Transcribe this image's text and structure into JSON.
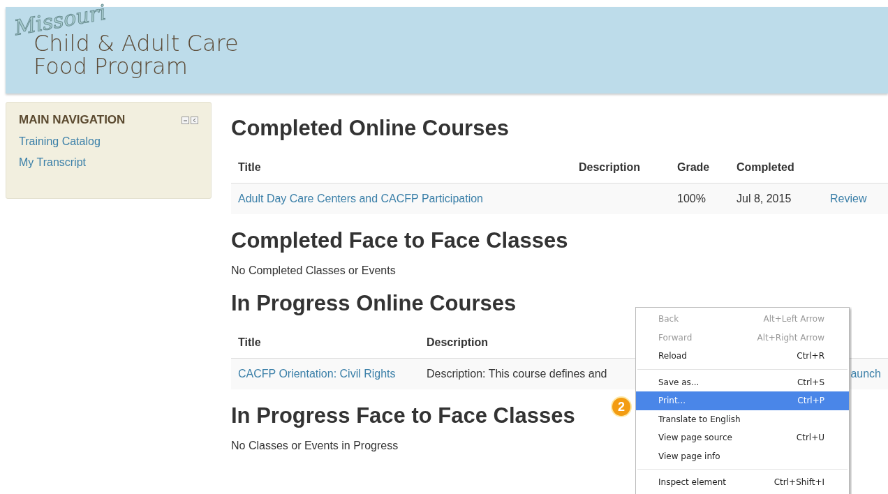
{
  "header": {
    "logo_script": "Missouri",
    "logo_line_1": "Child & Adult Care",
    "logo_line_2": "Food Program"
  },
  "sidebar": {
    "title": "MAIN NAVIGATION",
    "items": [
      {
        "label": "Training Catalog"
      },
      {
        "label": "My Transcript"
      }
    ]
  },
  "sections": [
    {
      "heading": "Completed Online Courses",
      "kind": "table",
      "columns": [
        "Title",
        "Description",
        "Grade",
        "Completed"
      ],
      "rows": [
        {
          "title": "Adult Day Care Centers and CACFP Participation",
          "grade": "100%",
          "completed": "Jul 8, 2015",
          "action": "Review"
        }
      ]
    },
    {
      "heading": "Completed Face to Face Classes",
      "kind": "empty",
      "message": "No Completed Classes or Events"
    },
    {
      "heading": "In Progress Online Courses",
      "kind": "table",
      "columns": [
        "Title",
        "Description"
      ],
      "rows": [
        {
          "title": "CACFP Orientation: Civil Rights",
          "description": "Description: This course defines and",
          "action": "aunch"
        }
      ]
    },
    {
      "heading": "In Progress Face to Face Classes",
      "kind": "empty",
      "message": "No Classes or Events in Progress"
    }
  ],
  "context_menu": {
    "items": [
      {
        "kind": "item",
        "label": "Back",
        "shortcut": "Alt+Left Arrow",
        "disabled": true,
        "selected": false
      },
      {
        "kind": "item",
        "label": "Forward",
        "shortcut": "Alt+Right Arrow",
        "disabled": true,
        "selected": false
      },
      {
        "kind": "item",
        "label": "Reload",
        "shortcut": "Ctrl+R",
        "disabled": false,
        "selected": false
      },
      {
        "kind": "separator"
      },
      {
        "kind": "item",
        "label": "Save as...",
        "shortcut": "Ctrl+S",
        "disabled": false,
        "selected": false
      },
      {
        "kind": "item",
        "label": "Print...",
        "shortcut": "Ctrl+P",
        "disabled": false,
        "selected": true
      },
      {
        "kind": "item",
        "label": "Translate to English",
        "disabled": false,
        "selected": false
      },
      {
        "kind": "item",
        "label": "View page source",
        "shortcut": "Ctrl+U",
        "disabled": false,
        "selected": false
      },
      {
        "kind": "item",
        "label": "View page info",
        "disabled": false,
        "selected": false
      },
      {
        "kind": "separator"
      },
      {
        "kind": "item",
        "label": "Inspect element",
        "shortcut": "Ctrl+Shift+I",
        "disabled": false,
        "selected": false
      }
    ]
  },
  "step_badge": "2"
}
